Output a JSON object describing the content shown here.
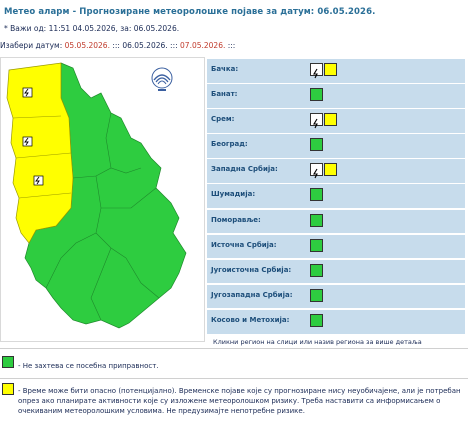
{
  "header": {
    "title": "Метео аларм - Прогнозиране метеоролошке појаве за датум:  06.05.2026.",
    "valid": "* Важи од: 11:51 04.05.2026, за: 06.05.2026.",
    "dates_label": "Изабери датум:",
    "date1": "05.05.2026.",
    "date2": "06.05.2026.",
    "date3": "07.05.2026.",
    "sep": ":::"
  },
  "regions": [
    {
      "name": "Бачка:",
      "level": "yellow",
      "thunder": true
    },
    {
      "name": "Банат:",
      "level": "green",
      "thunder": false
    },
    {
      "name": "Срем:",
      "level": "yellow",
      "thunder": true
    },
    {
      "name": "Београд:",
      "level": "green",
      "thunder": false
    },
    {
      "name": "Западна Србија:",
      "level": "yellow",
      "thunder": true
    },
    {
      "name": "Шумадија:",
      "level": "green",
      "thunder": false
    },
    {
      "name": "Поморавље:",
      "level": "green",
      "thunder": false
    },
    {
      "name": "Источна Србија:",
      "level": "green",
      "thunder": false
    },
    {
      "name": "Југоисточна Србија:",
      "level": "green",
      "thunder": false
    },
    {
      "name": "Југозападна Србија:",
      "level": "green",
      "thunder": false
    },
    {
      "name": "Косово и Метохија:",
      "level": "green",
      "thunder": false
    }
  ],
  "hint": "Кликни регион на слици или назив региона за више детаља",
  "legend": {
    "green_text": "- Не захтева се посебна приправност.",
    "yellow_text": "- Време може бити опасно (потенцијално). Временске појаве које су прогнозиране нису неуобичајене, али је потребан опрез ако планирате активности које су изложене метеоролошком ризику. Треба наставити са информисањем о очекиваним метеоролошким условима. Не предузимајте непотребне ризике."
  },
  "colors": {
    "green": "#2ecc40",
    "yellow": "#ffff00",
    "accent": "#2a6f97",
    "row_bg": "#c7dcec"
  }
}
